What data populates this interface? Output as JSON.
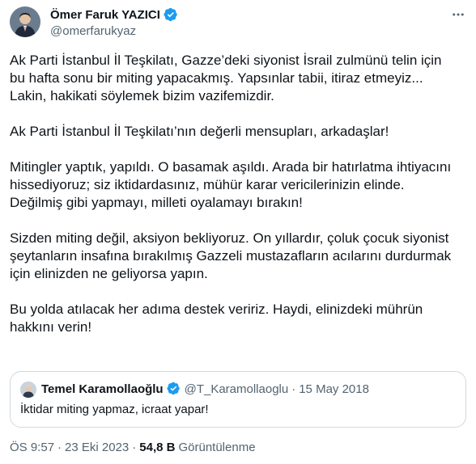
{
  "author": {
    "display_name": "Ömer Faruk YAZICI",
    "handle": "@omerfarukyaz"
  },
  "tweet": {
    "paragraphs": [
      "Ak Parti İstanbul İl Teşkilatı, Gazze’deki siyonist İsrail zulmünü telin için\nbu hafta sonu bir miting yapacakmış. Yapsınlar tabii, itiraz etmeyiz...\nLakin, hakikati söylemek bizim vazifemizdir.",
      "Ak Parti İstanbul İl Teşkilatı’nın değerli mensupları, arkadaşlar!",
      "Mitingler yaptık, yapıldı. O basamak aşıldı. Arada bir hatırlatma ihtiyacını\nhissediyoruz; siz iktidardasınız, mühür karar vericilerinizin elinde.\nDeğilmiş gibi yapmayı, milleti oyalamayı bırakın!",
      "Sizden miting değil, aksiyon bekliyoruz. On yıllardır, çoluk çocuk siyonist\nşeytanların insafına bırakılmış Gazzeli mustazafların acılarını durdurmak\niçin elinizden ne geliyorsa yapın.",
      "Bu yolda atılacak her adıma destek veririz. Haydi, elinizdeki mührün\nhakkını verin!"
    ]
  },
  "quote": {
    "display_name": "Temel Karamollaoğlu",
    "handle": "@T_Karamollaoglu",
    "separator": "·",
    "date": "15 May 2018",
    "text": "İktidar miting yapmaz, icraat yapar!"
  },
  "meta": {
    "time": "ÖS 9:57",
    "separator": "·",
    "date": "23 Eki 2023",
    "views_count": "54,8 B",
    "views_label": "Görüntülenme"
  },
  "colors": {
    "verified_badge": "#1d9bf0",
    "text_primary": "#0f1419",
    "text_secondary": "#536471",
    "border": "#cfd9de"
  },
  "icons": {
    "verified": "verified-badge-icon",
    "more": "more-options-icon"
  }
}
